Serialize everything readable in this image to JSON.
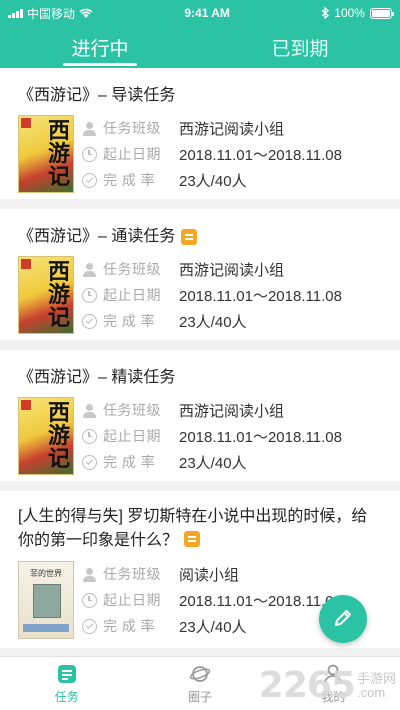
{
  "status_bar": {
    "carrier": "中国移动",
    "time": "9:41 AM",
    "battery": "100%"
  },
  "tabs": [
    {
      "label": "进行中",
      "active": true
    },
    {
      "label": "已到期",
      "active": false
    }
  ],
  "tasks": [
    {
      "title": "《西游记》– 导读任务",
      "has_note": false,
      "cover_text": "西游记",
      "class_label": "任务班级",
      "class_value": "西游记阅读小组",
      "date_label": "起止日期",
      "date_value": "2018.11.01～2018.11.08",
      "rate_label": "完 成 率",
      "rate_value": "23人/40人"
    },
    {
      "title": "《西游记》– 通读任务",
      "has_note": true,
      "cover_text": "西游记",
      "class_label": "任务班级",
      "class_value": "西游记阅读小组",
      "date_label": "起止日期",
      "date_value": "2018.11.01～2018.11.08",
      "rate_label": "完 成 率",
      "rate_value": "23人/40人"
    },
    {
      "title": "《西游记》– 精读任务",
      "has_note": false,
      "cover_text": "西游记",
      "class_label": "任务班级",
      "class_value": "西游记阅读小组",
      "date_label": "起止日期",
      "date_value": "2018.11.01～2018.11.08",
      "rate_label": "完 成 率",
      "rate_value": "23人/40人"
    },
    {
      "title": "[人生的得与失] 罗切斯特在小说中出现的时候，给你的第一印象是什么？",
      "has_note": true,
      "cover_text": "菲的世界",
      "class_label": "任务班级",
      "class_value": "阅读小组",
      "date_label": "起止日期",
      "date_value": "2018.11.01～2018.11.08",
      "rate_label": "完 成 率",
      "rate_value": "23人/40人"
    }
  ],
  "bottom_nav": [
    {
      "label": "任务",
      "active": true
    },
    {
      "label": "圈子",
      "active": false
    },
    {
      "label": "我的",
      "active": false
    }
  ],
  "watermark": {
    "number": "2265",
    "text1": "手游网",
    "text2": ".com"
  },
  "colors": {
    "accent": "#2bc3a3",
    "note_badge": "#f5a623"
  }
}
